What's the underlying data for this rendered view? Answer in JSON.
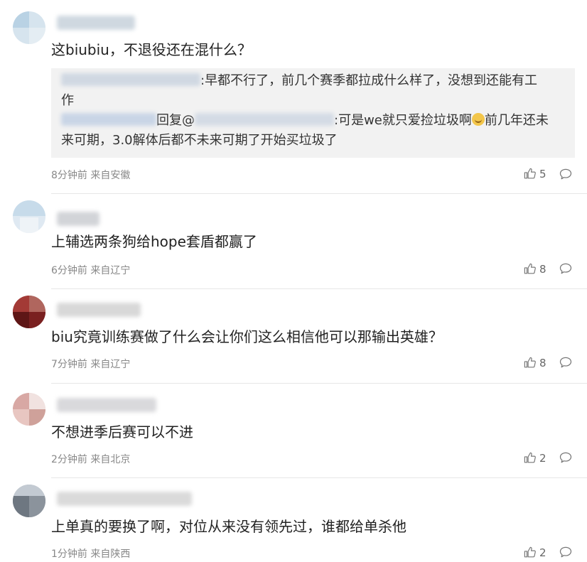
{
  "comments": [
    {
      "text": "这biubiu，不退役还在混什么？",
      "quote": {
        "line1": ":早都不行了，前几个赛季都拉成什么样了，没想到还能有工",
        "line1b": "作",
        "line2a": "回复@",
        "line2b": ":可是we就只爱捡垃圾啊",
        "line2c": "前几年还未",
        "line3": "来可期，3.0解体后都不未来可期了开始买垃圾了"
      },
      "time": "8分钟前",
      "location": "来自安徽",
      "likes": "5"
    },
    {
      "text": "上辅选两条狗给hope套盾都赢了",
      "time": "6分钟前",
      "location": "来自辽宁",
      "likes": "8"
    },
    {
      "text": "biu究竟训练赛做了什么会让你们这么相信他可以那输出英雄？",
      "time": "7分钟前",
      "location": "来自辽宁",
      "likes": "8"
    },
    {
      "text": "不想进季后赛可以不进",
      "time": "2分钟前",
      "location": "来自北京",
      "likes": "2"
    },
    {
      "text": "上单真的要换了啊，对位从来没有领先过，谁都给单杀他",
      "time": "1分钟前",
      "location": "来自陕西",
      "likes": "2"
    }
  ],
  "icons": {
    "like": "thumbs-up-icon",
    "reply": "comment-bubble-icon",
    "emoji": "crying-laugh-emoji"
  },
  "colors": {
    "meta": "#888888",
    "quote_bg": "#f2f2f2",
    "divider": "#e6e6e6"
  }
}
